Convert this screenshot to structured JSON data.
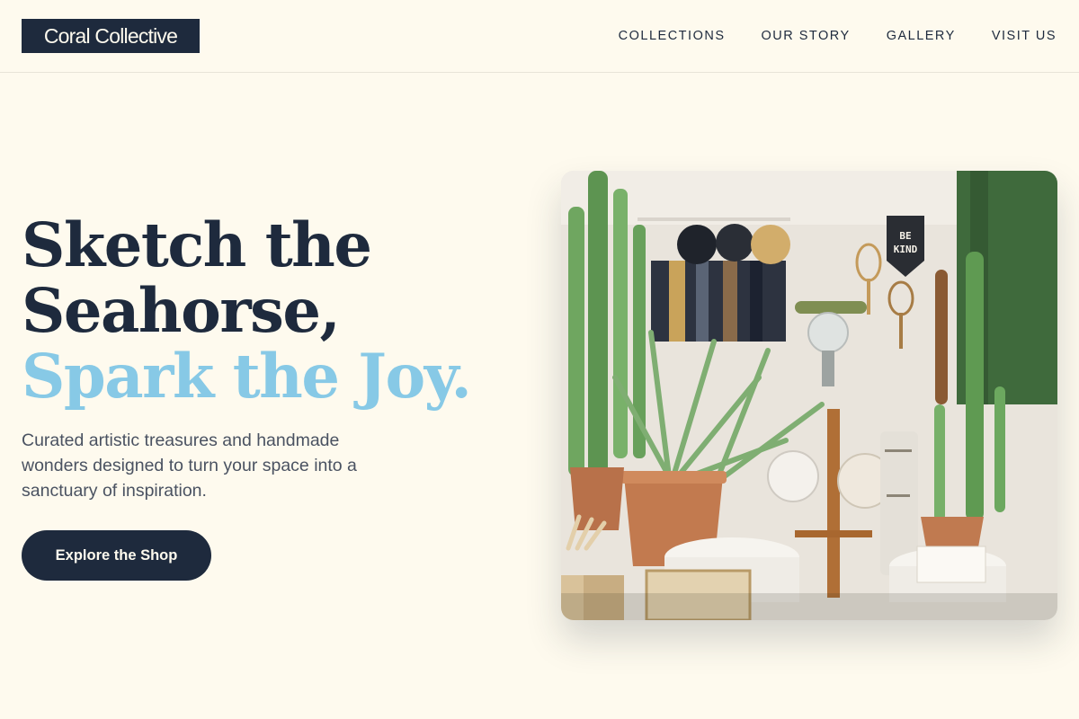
{
  "header": {
    "logo_text": "Coral Collective",
    "nav": [
      {
        "label": "COLLECTIONS"
      },
      {
        "label": "OUR STORY"
      },
      {
        "label": "GALLERY"
      },
      {
        "label": "VISIT US"
      }
    ]
  },
  "hero": {
    "headline_line1": "Sketch the",
    "headline_line2": "Seahorse,",
    "headline_line3": "Spark the Joy.",
    "subtext": "Curated artistic treasures and handmade wonders designed to turn your space into a sanctuary of inspiration.",
    "cta_label": "Explore the Shop",
    "image": {
      "pennant_text": "BE KIND"
    }
  },
  "colors": {
    "background": "#fefaee",
    "navy": "#1e2a3d",
    "accent_blue": "#87c9e6"
  }
}
